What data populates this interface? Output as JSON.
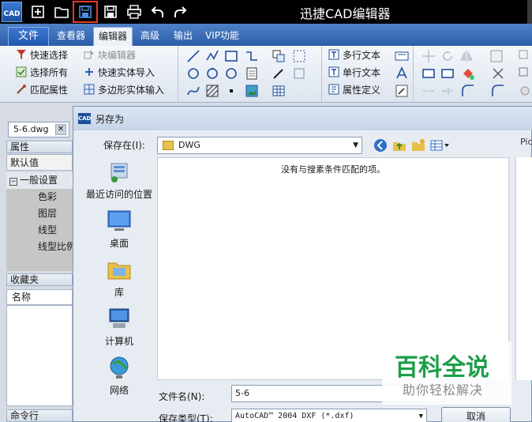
{
  "app": {
    "title": "迅捷CAD编辑器",
    "icon_text": "CAD"
  },
  "quick_access": [
    {
      "name": "new-file-icon",
      "glyph": "plus"
    },
    {
      "name": "open-folder-icon",
      "glyph": "folder"
    },
    {
      "name": "save-icon",
      "glyph": "floppy",
      "highlighted": true
    },
    {
      "name": "save-as-icon",
      "glyph": "floppy"
    },
    {
      "name": "print-icon",
      "glyph": "printer"
    },
    {
      "name": "undo-icon",
      "glyph": "undo"
    },
    {
      "name": "redo-icon",
      "glyph": "redo"
    }
  ],
  "tabs": {
    "file": "文件",
    "viewer": "查看器",
    "editor": "编辑器",
    "advanced": "高级",
    "output": "输出",
    "vip": "VIP功能"
  },
  "ribbon": {
    "quick_select": "快速选择",
    "block_editor": "块编辑器",
    "select_all": "选择所有",
    "quick_entity_import": "快速实体导入",
    "match_properties": "匹配属性",
    "polygon_entity_input": "多边形实体输入",
    "multiline_text": "多行文本",
    "single_line_text": "单行文本",
    "attribute_definition": "属性定义"
  },
  "left_panel": {
    "doc_tab": "5-6.dwg",
    "properties_head": "属性",
    "default_value": "默认值",
    "general_group": "一般设置",
    "color": "色彩",
    "layer": "图层",
    "linetype": "线型",
    "linetype_scale": "线型比例",
    "favorites_head": "收藏夹",
    "name_col": "名称",
    "command_line": "命令行"
  },
  "dialog": {
    "title": "另存为",
    "icon_text": "CAD",
    "save_in_label": "保存在(I):",
    "save_in_value": "DWG",
    "empty_message": "没有与搜素条件匹配的项。",
    "pict_label": "Pict",
    "places": {
      "recent": "最近访问的位置",
      "desktop": "桌面",
      "library": "库",
      "computer": "计算机",
      "network": "网络"
    },
    "filename_label": "文件名(N):",
    "filename_value": "5-6",
    "filetype_label": "保存类型(T):",
    "filetype_value": "AutoCAD™ 2004 DXF (*.dxf)",
    "cancel": "取消"
  },
  "watermark": {
    "line1": "百科全说",
    "line2": "助你轻松解决"
  },
  "colors": {
    "titlebar": "#000000",
    "tabrow": "#2c5ea8",
    "highlight_border": "#e23a2e",
    "watermark_green": "#1d9e4a"
  }
}
